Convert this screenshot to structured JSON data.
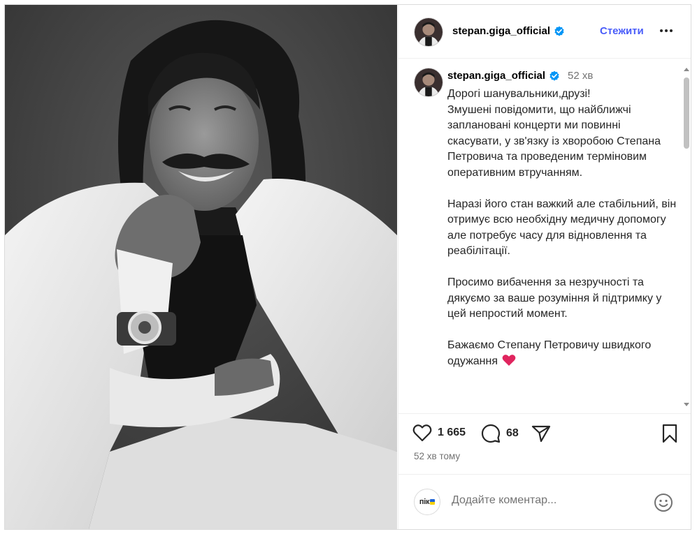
{
  "post": {
    "author": {
      "username": "stepan.giga_official",
      "verified": true,
      "follow_label": "Стежити"
    },
    "caption": {
      "time_ago": "52 хв",
      "text": "Дорогі шанувальники,друзі!\nЗмушені повідомити, що найближчі заплановані концерти ми повинні скасувати, у зв'язку із хворобою Степана Петровича та проведеним терміновим оперативним втручанням.\n\nНаразі його стан важкий але стабільний, він отримує всю необхідну медичну допомогу але потребує часу для відновлення та реабілітації.\n\nПросимо вибачення за незручності та дякуємо за ваше розуміння й підтримку у цей непростий момент.\n\nБажаємо Степану Петровичу швидкого одужання"
    },
    "stats": {
      "likes": "1 665",
      "comments": "68"
    },
    "timestamp": "52 хв тому"
  },
  "comment_box": {
    "placeholder": "Додайте коментар...",
    "avatar_label": "пік"
  },
  "icons": {
    "like": "heart-outline-icon",
    "comment": "speech-bubble-icon",
    "share": "paper-plane-icon",
    "save": "bookmark-icon",
    "emoji": "smiley-icon",
    "more": "three-dots-icon",
    "verified": "verified-badge-icon"
  },
  "colors": {
    "accent": "#4a5df9",
    "verified": "#0095f6",
    "heart": "#e0245e",
    "secondary_text": "#737373"
  }
}
